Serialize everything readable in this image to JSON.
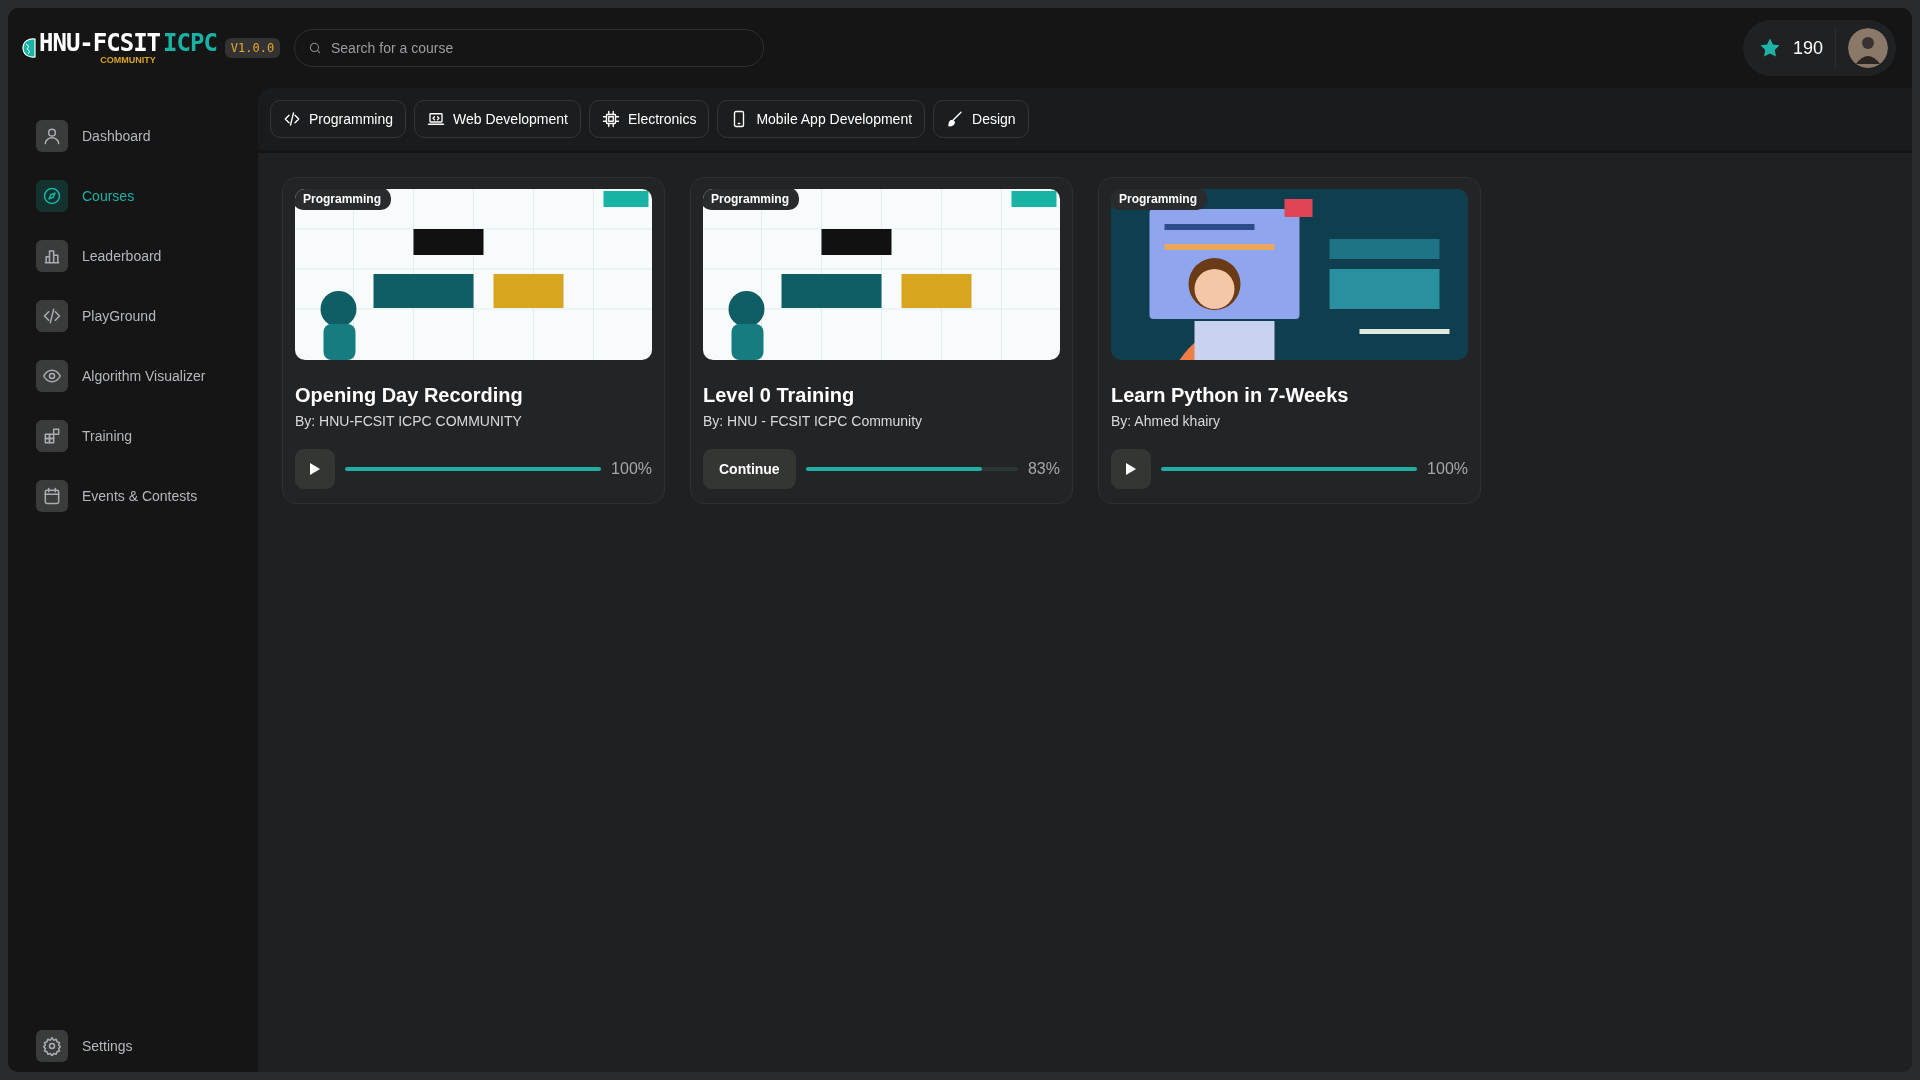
{
  "logo": {
    "main": "HNU-FCSIT",
    "accent": "ICPC",
    "sub": "COMMUNITY",
    "version": "V1.0.0"
  },
  "search": {
    "placeholder": "Search for a course"
  },
  "user": {
    "points": "190"
  },
  "sidebar": {
    "items": [
      {
        "label": "Dashboard",
        "selected": false
      },
      {
        "label": "Courses",
        "selected": true
      },
      {
        "label": "Leaderboard",
        "selected": false
      },
      {
        "label": "PlayGround",
        "selected": false
      },
      {
        "label": "Algorithm Visualizer",
        "selected": false
      },
      {
        "label": "Training",
        "selected": false
      },
      {
        "label": "Events & Contests",
        "selected": false
      }
    ],
    "footer": {
      "label": "Settings",
      "selected": false
    }
  },
  "categories": [
    {
      "label": "Programming",
      "selected": false
    },
    {
      "label": "Web Development",
      "selected": false
    },
    {
      "label": "Electronics",
      "selected": false
    },
    {
      "label": "Mobile App Development",
      "selected": false
    },
    {
      "label": "Design",
      "selected": false
    }
  ],
  "courses": [
    {
      "tag": "Programming",
      "title": "Opening Day Recording",
      "author": "By: HNU-FCSIT ICPC COMMUNITY",
      "action": {
        "kind": "play"
      },
      "level": 1,
      "percent": "100%"
    },
    {
      "tag": "Programming",
      "title": "Level 0 Training",
      "author": "By: HNU - FCSIT ICPC Community",
      "action": {
        "kind": "text",
        "label": "Continue"
      },
      "level": 0.83,
      "percent": "83%"
    },
    {
      "tag": "Programming",
      "title": "Learn Python in 7-Weeks",
      "author": "By: Ahmed khairy",
      "action": {
        "kind": "play"
      },
      "level": 1,
      "percent": "100%"
    }
  ]
}
